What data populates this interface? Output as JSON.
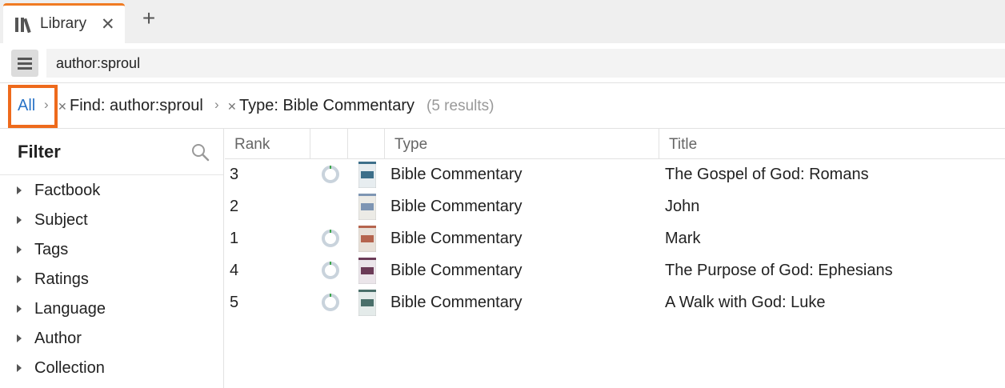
{
  "tab": {
    "label": "Library",
    "icon": "library-icon"
  },
  "search": {
    "value": "author:sproul"
  },
  "breadcrumb": {
    "all": "All",
    "find": "Find: author:sproul",
    "type": "Type: Bible Commentary",
    "count": "(5 results)"
  },
  "filter": {
    "title": "Filter",
    "items": [
      "Factbook",
      "Subject",
      "Tags",
      "Ratings",
      "Language",
      "Author",
      "Collection"
    ]
  },
  "table": {
    "columns": [
      "Rank",
      "",
      "",
      "Type",
      "Title"
    ],
    "rows": [
      {
        "rank": "3",
        "type": "Bible Commentary",
        "title": "The Gospel of God: Romans",
        "has_progress": true,
        "cover_colors": [
          "#3d6f8a",
          "#e7edf0"
        ]
      },
      {
        "rank": "2",
        "type": "Bible Commentary",
        "title": "John",
        "has_progress": false,
        "cover_colors": [
          "#7e95b3",
          "#ecebe6"
        ]
      },
      {
        "rank": "1",
        "type": "Bible Commentary",
        "title": "Mark",
        "has_progress": true,
        "cover_colors": [
          "#b5644e",
          "#e8e0d8"
        ]
      },
      {
        "rank": "4",
        "type": "Bible Commentary",
        "title": "The Purpose of God: Ephesians",
        "has_progress": true,
        "cover_colors": [
          "#6b3b57",
          "#ebe5ea"
        ]
      },
      {
        "rank": "5",
        "type": "Bible Commentary",
        "title": "A Walk with God: Luke",
        "has_progress": true,
        "cover_colors": [
          "#4a6f6a",
          "#e4ebea"
        ]
      }
    ]
  },
  "colors": {
    "accent": "#f07b22",
    "link": "#2a74c7",
    "highlight_box": "#ee6a1c",
    "progress_ring": "#c9d3dc",
    "progress_tick": "#3aa54a"
  }
}
